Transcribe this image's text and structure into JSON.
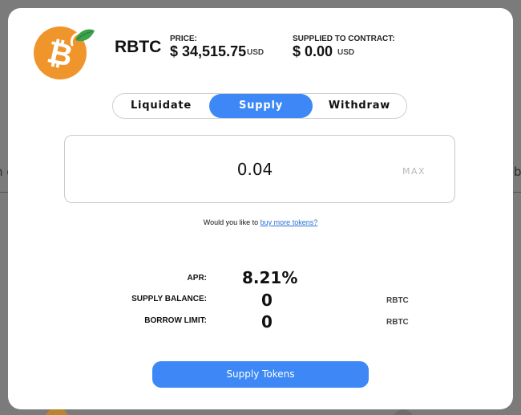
{
  "background": {
    "left_fragment": "n c",
    "right_fragment": "b"
  },
  "token": {
    "name": "RBTC",
    "logo_icon": "bitcoin-with-leaf-icon",
    "logo_glyph": "₿",
    "brand_color": "#f0952c"
  },
  "price": {
    "label": "PRICE:",
    "value": "$ 34,515.75",
    "unit": "USD"
  },
  "supplied": {
    "label": "SUPPLIED TO CONTRACT:",
    "value": "$ 0.00",
    "unit": "USD"
  },
  "tabs": [
    {
      "label": "Liquidate",
      "active": false
    },
    {
      "label": "Supply",
      "active": true
    },
    {
      "label": "Withdraw",
      "active": false
    }
  ],
  "amount_input": {
    "value": "0.04",
    "max_label": "MAX"
  },
  "buy_prompt": {
    "text": "Would you like to",
    "link": "buy more tokens?"
  },
  "metrics": {
    "apr": {
      "label": "APR:",
      "value": "8.21%"
    },
    "supply_balance": {
      "label": "SUPPLY BALANCE:",
      "value": "0",
      "unit": "RBTC"
    },
    "borrow_limit": {
      "label": "BORROW LIMIT:",
      "value": "0",
      "unit": "RBTC"
    }
  },
  "submit_label": "Supply Tokens",
  "colors": {
    "accent": "#3d88f6",
    "link": "#2a6ed6",
    "overlay": "#7b7b7b"
  }
}
